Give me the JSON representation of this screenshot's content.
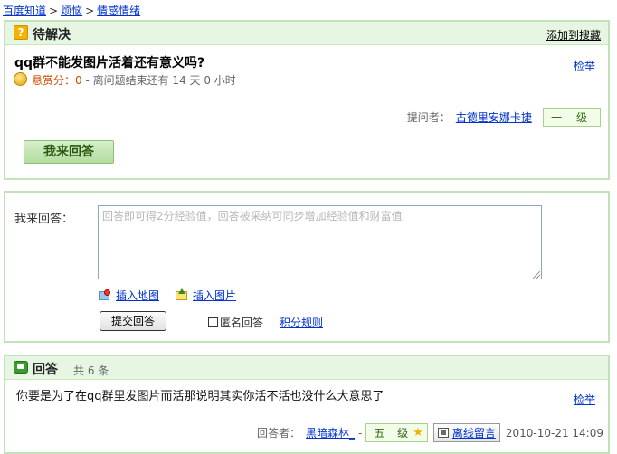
{
  "breadcrumb": {
    "items": [
      "百度知道",
      "烦恼",
      "情感情绪"
    ],
    "separator": ">"
  },
  "pending": {
    "title": "待解决",
    "add_fav": "添加到搜藏",
    "question": "qq群不能发图片活着还有意义吗?",
    "report": "检举",
    "reward_label": "悬赏分：",
    "reward_value": "0",
    "remaining": " - 离问题结束还有 14 天 0 小时",
    "asker_label": "提问者：",
    "asker_name": "古德里安娜卡捷",
    "asker_dash": "-",
    "asker_level": "一 级",
    "answer_button": "我来回答"
  },
  "reply": {
    "label": "我来回答：",
    "placeholder": "回答即可得2分经验值，回答被采纳可同步增加经验值和财富值",
    "insert_map": "插入地图",
    "insert_image": "插入图片",
    "submit": "提交回答",
    "anonymous": "匿名回答",
    "rules": "积分规则"
  },
  "answers": {
    "title": "回答",
    "count": "共 6 条",
    "items": [
      {
        "text": "你要是为了在qq群里发图片而活那说明其实你活不活也没什么大意思了",
        "report": "检举",
        "answerer_label": "回答者：",
        "answerer_name": "黑暗森林_",
        "dash": "-",
        "level": "五 级",
        "message": "离线留言",
        "time": "2010-10-21 14:09"
      }
    ]
  },
  "colors": {
    "panel_border": "#c2e3b7",
    "panel_head": "#e7f6e2",
    "link": "#0033cc",
    "reward": "#d04a00"
  },
  "icons": [
    "question-icon",
    "coin-icon",
    "map-icon",
    "image-icon",
    "chat-icon",
    "star-icon",
    "message-icon"
  ]
}
